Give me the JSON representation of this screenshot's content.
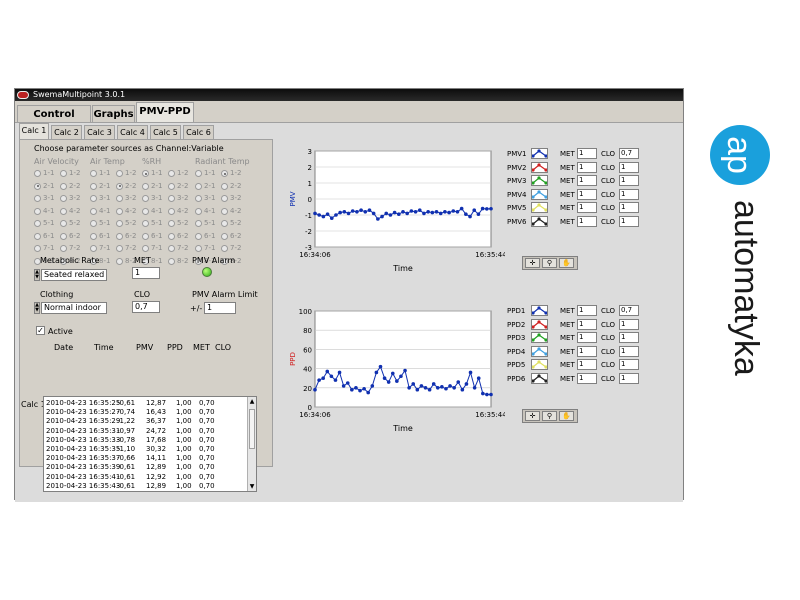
{
  "window": {
    "title": "SwemaMultipoint 3.0.1"
  },
  "main_tabs": [
    {
      "label": "Control Board"
    },
    {
      "label": "Graphs"
    },
    {
      "label": "PMV-PPD"
    }
  ],
  "calc_tabs": [
    {
      "label": "Calc 1"
    },
    {
      "label": "Calc 2"
    },
    {
      "label": "Calc 3"
    },
    {
      "label": "Calc 4"
    },
    {
      "label": "Calc 5"
    },
    {
      "label": "Calc 6"
    }
  ],
  "params": {
    "heading": "Choose parameter sources as Channel:Variable",
    "columns": [
      {
        "title": "Air Velocity",
        "selected": "2-1"
      },
      {
        "title": "Air Temp",
        "selected": "2-2"
      },
      {
        "title": "%RH",
        "selected": "1-1"
      },
      {
        "title": "Radiant Temp",
        "selected": "1-2"
      }
    ],
    "options": [
      [
        "1-1",
        "1-2"
      ],
      [
        "2-1",
        "2-2"
      ],
      [
        "3-1",
        "3-2"
      ],
      [
        "4-1",
        "4-2"
      ],
      [
        "5-1",
        "5-2"
      ],
      [
        "6-1",
        "6-2"
      ],
      [
        "7-1",
        "7-2"
      ],
      [
        "8-1",
        "8-2"
      ]
    ]
  },
  "metabolic": {
    "label": "Metabolic Rate",
    "value": "Seated relaxed"
  },
  "met": {
    "label": "MET",
    "value": "1"
  },
  "pmv_alarm": {
    "label": "PMV Alarm"
  },
  "clothing": {
    "label": "Clothing",
    "value": "Normal indoor"
  },
  "clo": {
    "label": "CLO",
    "value": "0,7"
  },
  "pmv_alarm_limit": {
    "label": "PMV Alarm Limit",
    "prefix": "+/-",
    "value": "1"
  },
  "active": {
    "label": "Active",
    "checked": true
  },
  "log": {
    "row_label": "Calc 1",
    "headers": [
      "Date",
      "Time",
      "PMV",
      "PPD",
      "MET",
      "CLO"
    ],
    "rows": [
      [
        "2010-04-23 16:35:25",
        "-0,61",
        "12,87",
        "1,00",
        "0,70"
      ],
      [
        "2010-04-23 16:35:27",
        "-0,74",
        "16,43",
        "1,00",
        "0,70"
      ],
      [
        "2010-04-23 16:35:29",
        "-1,22",
        "36,37",
        "1,00",
        "0,70"
      ],
      [
        "2010-04-23 16:35:31",
        "-0,97",
        "24,72",
        "1,00",
        "0,70"
      ],
      [
        "2010-04-23 16:35:33",
        "-0,78",
        "17,68",
        "1,00",
        "0,70"
      ],
      [
        "2010-04-23 16:35:35",
        "-1,10",
        "30,32",
        "1,00",
        "0,70"
      ],
      [
        "2010-04-23 16:35:37",
        "-0,66",
        "14,11",
        "1,00",
        "0,70"
      ],
      [
        "2010-04-23 16:35:39",
        "-0,61",
        "12,89",
        "1,00",
        "0,70"
      ],
      [
        "2010-04-23 16:35:41",
        "-0,61",
        "12,92",
        "1,00",
        "0,70"
      ],
      [
        "2010-04-23 16:35:43",
        "-0,61",
        "12,89",
        "1,00",
        "0,70"
      ]
    ]
  },
  "chart_data": [
    {
      "type": "line",
      "ylabel": "PMV",
      "xlabel": "Time",
      "xticks": [
        "16:34:06",
        "16:35:44"
      ],
      "ylim": [
        -3,
        3
      ],
      "yticks": [
        "3",
        "2",
        "1",
        "0",
        "-1",
        "-2",
        "-3"
      ],
      "grid": true,
      "color": "#1030b0",
      "values": [
        -0.9,
        -1.0,
        -1.1,
        -0.95,
        -1.2,
        -1.0,
        -0.85,
        -0.8,
        -0.9,
        -0.75,
        -0.8,
        -0.7,
        -0.8,
        -0.7,
        -0.9,
        -1.25,
        -1.1,
        -0.9,
        -1.0,
        -0.85,
        -0.95,
        -0.8,
        -0.9,
        -0.75,
        -0.8,
        -0.7,
        -0.9,
        -0.8,
        -0.85,
        -0.8,
        -0.9,
        -0.8,
        -0.85,
        -0.75,
        -0.8,
        -0.6,
        -0.95,
        -1.1,
        -0.7,
        -0.95,
        -0.6,
        -0.62,
        -0.61
      ]
    },
    {
      "type": "line",
      "ylabel": "PPD",
      "xlabel": "Time",
      "xticks": [
        "16:34:06",
        "16:35:44"
      ],
      "ylim": [
        0,
        100
      ],
      "yticks": [
        "100",
        "80",
        "60",
        "40",
        "20",
        "0"
      ],
      "grid": true,
      "color": "#1030b0",
      "values": [
        18,
        28,
        30,
        37,
        32,
        28,
        36,
        22,
        25,
        18,
        20,
        17,
        19,
        15,
        22,
        36,
        42,
        30,
        26,
        35,
        27,
        32,
        38,
        20,
        24,
        18,
        22,
        20,
        18,
        24,
        20,
        21,
        19,
        22,
        20,
        26,
        18,
        24,
        36,
        20,
        30,
        14,
        13,
        13
      ]
    }
  ],
  "pmv_legend": [
    {
      "name": "PMV1",
      "color": "#1030b0",
      "met": "1",
      "clo": "0,7"
    },
    {
      "name": "PMV2",
      "color": "#d02020",
      "met": "1",
      "clo": "1"
    },
    {
      "name": "PMV3",
      "color": "#20a020",
      "met": "1",
      "clo": "1"
    },
    {
      "name": "PMV4",
      "color": "#40a0e0",
      "met": "1",
      "clo": "1"
    },
    {
      "name": "PMV5",
      "color": "#e0e060",
      "met": "1",
      "clo": "1"
    },
    {
      "name": "PMV6",
      "color": "#202020",
      "met": "1",
      "clo": "1"
    }
  ],
  "ppd_legend": [
    {
      "name": "PPD1",
      "color": "#1030b0",
      "met": "1",
      "clo": "0,7"
    },
    {
      "name": "PPD2",
      "color": "#d02020",
      "met": "1",
      "clo": "1"
    },
    {
      "name": "PPD3",
      "color": "#20a020",
      "met": "1",
      "clo": "1"
    },
    {
      "name": "PPD4",
      "color": "#40a0e0",
      "met": "1",
      "clo": "1"
    },
    {
      "name": "PPD5",
      "color": "#e0e060",
      "met": "1",
      "clo": "1"
    },
    {
      "name": "PPD6",
      "color": "#202020",
      "met": "1",
      "clo": "1"
    }
  ],
  "legend_labels": {
    "met": "MET",
    "clo": "CLO"
  },
  "logo": {
    "part1": "ap",
    "part2": "automatyka",
    "color": "#1aa0dc"
  }
}
